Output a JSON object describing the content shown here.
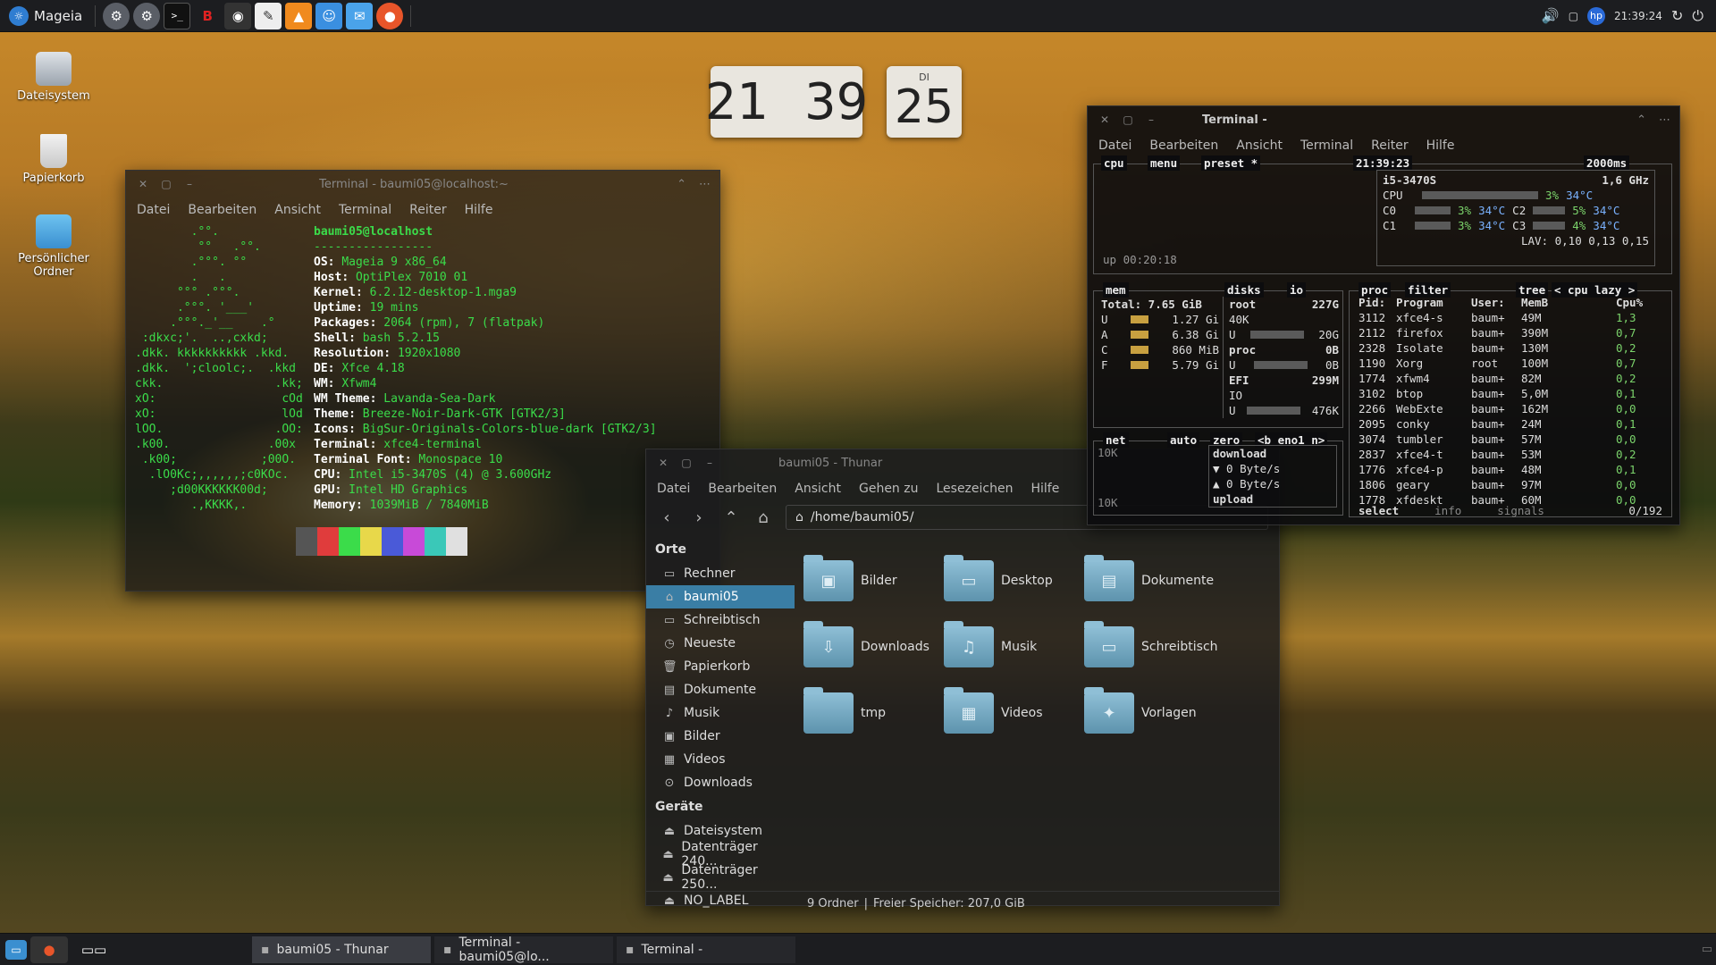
{
  "top_panel": {
    "menu_label": "Mageia",
    "launchers": [
      "settings-icon",
      "settings-alt-icon",
      "terminal-icon",
      "task-manager-icon",
      "screenshot-icon",
      "text-editor-icon",
      "vlc-icon",
      "finder-icon",
      "mail-icon",
      "firefox-icon"
    ],
    "time": "21:39:24"
  },
  "desktop_icons": [
    {
      "label": "Dateisystem",
      "name": "filesystem"
    },
    {
      "label": "Papierkorb",
      "name": "trash"
    },
    {
      "label": "Persönlicher Ordner",
      "name": "home-folder"
    }
  ],
  "clock": {
    "hours": "21",
    "minutes": "39",
    "weekday": "DI",
    "day": "25"
  },
  "neofetch": {
    "title": "Terminal - baumi05@localhost:~",
    "menu": [
      "Datei",
      "Bearbeiten",
      "Ansicht",
      "Terminal",
      "Reiter",
      "Hilfe"
    ],
    "logo": "        .°°.\n         °°   .°°.\n        .°°°. °°\n        .   .\n      °°° .°°°.\n      .°°°. '___'\n     .°°°._'__    .°\n :dkxc;'.  ..,cxkd;\n.dkk. kkkkkkkkkk .kkd.\n.dkk.  ';cloolc;.  .kkd\nckk.                .kk;\nxO:                  cOd\nxO:                  lOd\nlOO.                .OO:\n.k00.              .00x\n .k00;            ;00O.\n  .lO0Kc;,,,,,,;c0KOc.\n     ;d00KKKKKK00d;\n        .,KKKK,.",
    "header": "baumi05@localhost",
    "divider": "-----------------",
    "info": [
      {
        "k": "OS",
        "v": "Mageia 9 x86_64"
      },
      {
        "k": "Host",
        "v": "OptiPlex 7010 01"
      },
      {
        "k": "Kernel",
        "v": "6.2.12-desktop-1.mga9"
      },
      {
        "k": "Uptime",
        "v": "19 mins"
      },
      {
        "k": "Packages",
        "v": "2064 (rpm), 7 (flatpak)"
      },
      {
        "k": "Shell",
        "v": "bash 5.2.15"
      },
      {
        "k": "Resolution",
        "v": "1920x1080"
      },
      {
        "k": "DE",
        "v": "Xfce 4.18"
      },
      {
        "k": "WM",
        "v": "Xfwm4"
      },
      {
        "k": "WM Theme",
        "v": "Lavanda-Sea-Dark"
      },
      {
        "k": "Theme",
        "v": "Breeze-Noir-Dark-GTK [GTK2/3]"
      },
      {
        "k": "Icons",
        "v": "BigSur-Originals-Colors-blue-dark [GTK2/3]"
      },
      {
        "k": "Terminal",
        "v": "xfce4-terminal"
      },
      {
        "k": "Terminal Font",
        "v": "Monospace 10"
      },
      {
        "k": "CPU",
        "v": "Intel i5-3470S (4) @ 3.600GHz"
      },
      {
        "k": "GPU",
        "v": "Intel HD Graphics"
      },
      {
        "k": "Memory",
        "v": "1039MiB / 7840MiB"
      }
    ],
    "palette": [
      "#555555",
      "#e03c3c",
      "#3bdc4a",
      "#e8d84a",
      "#4a5ad8",
      "#c84ad8",
      "#3ac8b8",
      "#e0e0e0"
    ]
  },
  "thunar": {
    "title": "baumi05 - Thunar",
    "menu": [
      "Datei",
      "Bearbeiten",
      "Ansicht",
      "Gehen zu",
      "Lesezeichen",
      "Hilfe"
    ],
    "path": "/home/baumi05/",
    "places_header": "Orte",
    "places": [
      {
        "label": "Rechner",
        "icon": "computer-icon"
      },
      {
        "label": "baumi05",
        "icon": "home-icon"
      },
      {
        "label": "Schreibtisch",
        "icon": "desktop-icon"
      },
      {
        "label": "Neueste",
        "icon": "recent-icon"
      },
      {
        "label": "Papierkorb",
        "icon": "trash-icon"
      },
      {
        "label": "Dokumente",
        "icon": "documents-icon"
      },
      {
        "label": "Musik",
        "icon": "music-icon"
      },
      {
        "label": "Bilder",
        "icon": "pictures-icon"
      },
      {
        "label": "Videos",
        "icon": "videos-icon"
      },
      {
        "label": "Downloads",
        "icon": "downloads-icon"
      }
    ],
    "devices_header": "Geräte",
    "devices": [
      {
        "label": "Dateisystem",
        "icon": "drive-icon"
      },
      {
        "label": "Datenträger 240...",
        "icon": "drive-icon"
      },
      {
        "label": "Datenträger 250...",
        "icon": "drive-icon"
      },
      {
        "label": "NO_LABEL",
        "icon": "drive-icon"
      }
    ],
    "folders": [
      {
        "label": "Bilder",
        "glyph": "▣"
      },
      {
        "label": "Desktop",
        "glyph": "▭"
      },
      {
        "label": "Dokumente",
        "glyph": "▤"
      },
      {
        "label": "Downloads",
        "glyph": "⇩"
      },
      {
        "label": "Musik",
        "glyph": "♫"
      },
      {
        "label": "Schreibtisch",
        "glyph": "▭"
      },
      {
        "label": "tmp",
        "glyph": ""
      },
      {
        "label": "Videos",
        "glyph": "▦"
      },
      {
        "label": "Vorlagen",
        "glyph": "✦"
      }
    ],
    "status_count": "9 Ordner",
    "status_sep": "|",
    "status_free": "Freier Speicher: 207,0 GiB"
  },
  "btop": {
    "title": "Terminal -",
    "menu": [
      "Datei",
      "Bearbeiten",
      "Ansicht",
      "Terminal",
      "Reiter",
      "Hilfe"
    ],
    "cpu_tabs": [
      "cpu",
      "menu",
      "preset *"
    ],
    "time": "21:39:23",
    "interval": "2000ms",
    "model": "i5-3470S",
    "freq": "1,6 GHz",
    "cpu_rows": [
      {
        "name": "CPU",
        "pct": "3%",
        "temp": "34°C"
      },
      {
        "name": "C0",
        "pct": "3%",
        "temp": "34°C",
        "name2": "C2",
        "pct2": "5%",
        "temp2": "34°C"
      },
      {
        "name": "C1",
        "pct": "3%",
        "temp": "34°C",
        "name2": "C3",
        "pct2": "4%",
        "temp2": "34°C"
      }
    ],
    "lav": "LAV: 0,10 0,13 0,15",
    "uptime": "up 00:20:18",
    "mem_label": "mem",
    "mem_total": "Total: 7.65 GiB",
    "mem_rows": [
      {
        "k": "U",
        "v": "1.27 Gi"
      },
      {
        "k": "A",
        "v": "6.38 Gi"
      },
      {
        "k": "C",
        "v": "860 MiB"
      },
      {
        "k": "F",
        "v": "5.79 Gi"
      }
    ],
    "disks_label": "disks",
    "io_label": "io",
    "disks": [
      {
        "name": "root",
        "size": "227G",
        "l1": "40K",
        "u": "U",
        "used": "20G"
      },
      {
        "name": "proc",
        "size": "0B",
        "u": "U",
        "used": "0B"
      },
      {
        "name": "EFI",
        "size": "299M",
        "io": "IO",
        "u": "U",
        "used": "476K"
      }
    ],
    "net_label": "net",
    "net_auto": "auto",
    "net_zero": "zero",
    "net_iface": "<b eno1 n>",
    "net_scale_top": "10K",
    "net_scale_bottom": "10K",
    "download": "download",
    "down_rate": "▼ 0 Byte/s",
    "up_rate": "▲ 0 Byte/s",
    "upload": "upload",
    "proc_label": "proc",
    "proc_filter": "filter",
    "proc_tree": "tree",
    "proc_sort": "< cpu lazy >",
    "proc_headers": [
      "Pid:",
      "Program",
      "User:",
      "MemB",
      "",
      "Cpu%"
    ],
    "procs": [
      [
        "3112",
        "xfce4-s",
        "baum+",
        "49M",
        "",
        "1,3"
      ],
      [
        "2112",
        "firefox",
        "baum+",
        "390M",
        "",
        "0,7"
      ],
      [
        "2328",
        "Isolate",
        "baum+",
        "130M",
        "",
        "0,2"
      ],
      [
        "1190",
        "Xorg",
        "root",
        "100M",
        "",
        "0,7"
      ],
      [
        "1774",
        "xfwm4",
        "baum+",
        "82M",
        "",
        "0,2"
      ],
      [
        "3102",
        "btop",
        "baum+",
        "5,0M",
        "",
        "0,1"
      ],
      [
        "2266",
        "WebExte",
        "baum+",
        "162M",
        "",
        "0,0"
      ],
      [
        "2095",
        "conky",
        "baum+",
        "24M",
        "",
        "0,1"
      ],
      [
        "3074",
        "tumbler",
        "baum+",
        "57M",
        "",
        "0,0"
      ],
      [
        "2837",
        "xfce4-t",
        "baum+",
        "53M",
        "",
        "0,2"
      ],
      [
        "1776",
        "xfce4-p",
        "baum+",
        "48M",
        "",
        "0,1"
      ],
      [
        "1806",
        "geary",
        "baum+",
        "97M",
        "",
        "0,0"
      ],
      [
        "1778",
        "xfdeskt",
        "baum+",
        "60M",
        "",
        "0,0"
      ]
    ],
    "footer_select": "select",
    "footer_info": "info",
    "footer_signals": "signals",
    "footer_count": "0/192"
  },
  "taskbar": [
    {
      "label": "baumi05 - Thunar",
      "icon": "thunar-icon"
    },
    {
      "label": "Terminal - baumi05@lo...",
      "icon": "terminal-icon"
    },
    {
      "label": "Terminal -",
      "icon": "terminal-icon"
    }
  ]
}
